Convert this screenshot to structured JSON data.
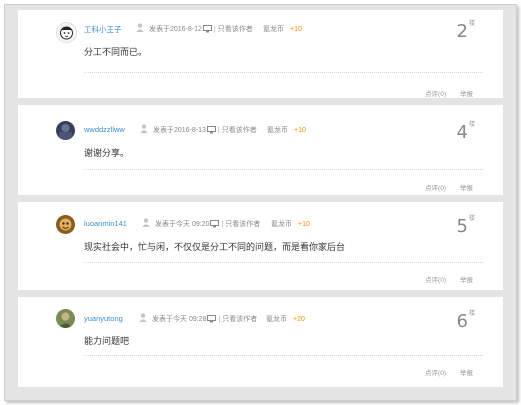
{
  "common": {
    "meta_sep": "|",
    "only_author": "只看该作者",
    "coin_label": "氪龙币",
    "comment": "点评(0)",
    "report": "举报",
    "floor_suffix": "楼"
  },
  "posts": [
    {
      "author": "工科小王子",
      "posted": "发表于2016-8-12",
      "coin_plus": "+10",
      "floor": "2",
      "content": "分工不同而已。",
      "avatar_color": "#f3f3f3"
    },
    {
      "author": "wwddzzllww",
      "posted": "发表于2016-8-13",
      "coin_plus": "+10",
      "floor": "4",
      "content": "谢谢分享。",
      "avatar_color": "#36405a"
    },
    {
      "author": "luoanmin141",
      "posted": "发表于今天 09:20",
      "coin_plus": "+10",
      "floor": "5",
      "content": "现实社会中，忙与闲，不仅仅是分工不同的问题，而是看你家后台",
      "avatar_color": "#b07a2a"
    },
    {
      "author": "yuanyutong",
      "posted": "发表于今天 09:28",
      "coin_plus": "+20",
      "floor": "6",
      "content": "能力问题吧",
      "avatar_color": "#6f7d4a"
    }
  ]
}
